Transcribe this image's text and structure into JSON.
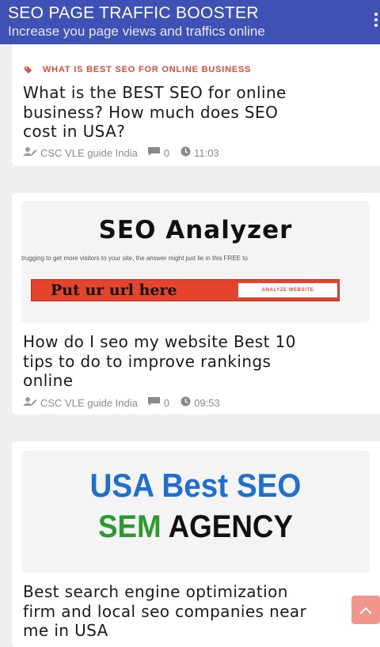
{
  "header": {
    "title": "SEO PAGE TRAFFIC BOOSTER",
    "subtitle": "Increase you page views and traffics online",
    "menu_icon": "more-vert-icon"
  },
  "posts": [
    {
      "category": "WHAT IS BEST SEO FOR ONLINE BUSINESS",
      "title_lines": [
        "What is the BEST SEO for online",
        "business? How much does SEO",
        "cost in USA?"
      ],
      "author": "CSC VLE guide India",
      "comments": "0",
      "time": "11:03"
    },
    {
      "thumbnail": {
        "heading": "SEO Analyzer",
        "tagline": "trugging to get more visitors to your site, the answer might just lie in this FREE to",
        "url_text": "Put ur url here",
        "button_text": "ANALYZE WEBSITE"
      },
      "title_lines": [
        "How do I seo my website Best 10",
        "tips to do to improve rankings",
        "online"
      ],
      "author": "CSC VLE guide India",
      "comments": "0",
      "time": "09:53"
    },
    {
      "thumbnail": {
        "line1": "USA Best SEO",
        "line2a": "SEM",
        "line2b": "AGENCY"
      },
      "title_lines": [
        "Best search engine optimization",
        "firm and local seo companies near",
        "me in USA"
      ]
    }
  ],
  "colors": {
    "appbar": "#3f51b5",
    "category": "#e0473f",
    "scroll_top": "#f0968a"
  },
  "scroll_top_icon": "chevron-up-icon"
}
